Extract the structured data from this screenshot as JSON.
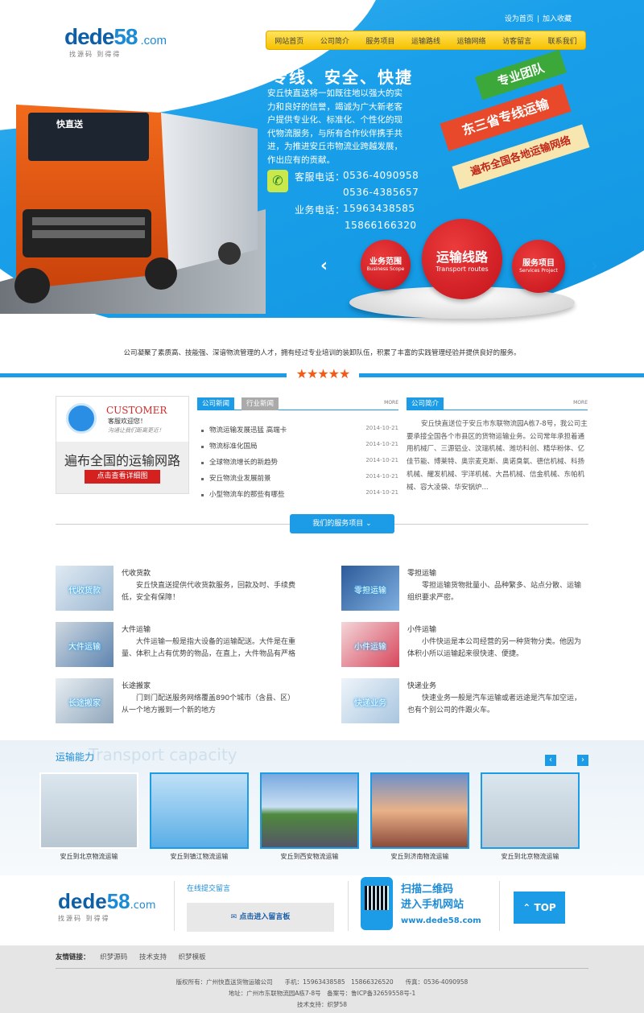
{
  "header": {
    "logo_main": "dede",
    "logo_num": "58",
    "logo_domain": ".com",
    "logo_sub": "找源码 到得得",
    "top_links": [
      "设为首页",
      "加入收藏"
    ],
    "nav": [
      "网站首页",
      "公司简介",
      "服务项目",
      "运输路线",
      "运输网络",
      "访客留言",
      "联系我们"
    ]
  },
  "hero": {
    "slogan": "专线、安全、快捷",
    "intro": "安丘快直送将一如既往地以强大的实力和良好的信誉，竭诚为广大新老客户提供专业化、标准化、个性化的现代物流服务，与所有合作伙伴携手共进，为推进安丘市物流业跨越发展，作出应有的贡献。",
    "service_label": "客服电话：",
    "service_phones": [
      "0536-4090958",
      "0536-4385657"
    ],
    "business_label": "业务电话：",
    "business_phones": [
      "15963438585",
      "15866166320"
    ],
    "truck_label": "快直送",
    "ribbons": [
      "专业团队",
      "东三省专线运输",
      "遍布全国各地运输网络"
    ],
    "circles": [
      {
        "zh": "业务范围",
        "en": "Business Scope"
      },
      {
        "zh": "运输线路",
        "en": "Transport routes"
      },
      {
        "zh": "服务项目",
        "en": "Services Project"
      }
    ]
  },
  "tagline": "公司凝聚了素质高、技能强、深谙物流管理的人才，拥有经过专业培训的装卸队伍，积累了丰富的实践管理经验并提供良好的服务。",
  "stars": "★★★★★",
  "customer": {
    "title": "CUSTOMER",
    "welcome": "客服欢迎您！",
    "note": "沟通让我们距离更近！",
    "network": "遍布全国的运输网路",
    "button": "点击查看详细图"
  },
  "news": {
    "tabs": [
      "公司新闻",
      "行业新闻"
    ],
    "more": "MORE",
    "items": [
      {
        "title": "物流运输发展迅猛 高端卡",
        "date": "2014-10-21"
      },
      {
        "title": "物流标准化国局",
        "date": "2014-10-21"
      },
      {
        "title": "全球物流增长的新趋势",
        "date": "2014-10-21"
      },
      {
        "title": "安丘物流业发展前景",
        "date": "2014-10-21"
      },
      {
        "title": "小型物流车的那些有哪些",
        "date": "2014-10-21"
      }
    ]
  },
  "about": {
    "tab": "公司简介",
    "more": "MORE",
    "text": "安丘快直送位于安丘市东联物流园A栋7-8号，我公司主要承接全国各个市县区的货物运输业务。公司常年承担着通用机械厂、三源铝业、汶瑞机械、潍坊科创、精华粉体、亿佳节能、博莱特、奥宗麦克斯、奥诺臭氧、德信机械、科扬机械、耀发机械、宇洋机械、大昌机械、信金机械、东帕机械、容大凌袋、华安锅炉..."
  },
  "services": {
    "button": "我们的服务项目",
    "items": [
      {
        "img": "代收货款",
        "title": "代收货款",
        "desc": "安丘快直送提供代收货款服务，回款及时、手续费低，安全有保障！"
      },
      {
        "img": "零担运输",
        "title": "零担运输",
        "desc": "零担运输货物批量小、品种繁多、站点分散、运输组织要求严密。"
      },
      {
        "img": "大件运输",
        "title": "大件运输",
        "desc": "大件运输一般是指大设备的运输配送。大件是在重量、体积上占有优势的物品，在直上，大件物品有严格"
      },
      {
        "img": "小件运输",
        "title": "小件运输",
        "desc": "小件快运是本公司经营的另一种货物分类。他因为体积小所以运输起来很快速、便捷。"
      },
      {
        "img": "长途搬家",
        "title": "长途搬家",
        "desc": "门到门配送服务网络覆盖890个城市（含县、区）从一个地方搬到一个新的地方"
      },
      {
        "img": "快递业务",
        "title": "快递业务",
        "desc": "快速业务一般是汽车运输或者远途是汽车加空运，也有个别公司的件跟火车。"
      }
    ]
  },
  "capacity": {
    "title": "运输能力",
    "title_en": "Transport capacity",
    "prev": "‹",
    "next": "›",
    "cards": [
      "安丘到北京物流运输",
      "安丘到镇江物流运输",
      "安丘到西安物流运输",
      "安丘到济南物流运输",
      "安丘到北京物流运输"
    ]
  },
  "footer": {
    "msg_label": "在线提交留言",
    "msg_button": "✉ 点击进入留言板",
    "qr_line1": "扫描二维码",
    "qr_line2": "进入手机网站",
    "qr_url": "www.dede58.com",
    "top": "TOP",
    "links_label": "友情链接：",
    "links": [
      "织梦源码",
      "技术支持",
      "织梦模板"
    ],
    "copy1": "版权所有：广州快直送货物运输公司　　手机：15963438585　15866326520　　传真：0536-4090958",
    "copy2": "地址：广州市东联物流园A栋7-8号　备案号：鲁ICP备32659558号-1",
    "copy3": "技术支持：织梦58"
  }
}
